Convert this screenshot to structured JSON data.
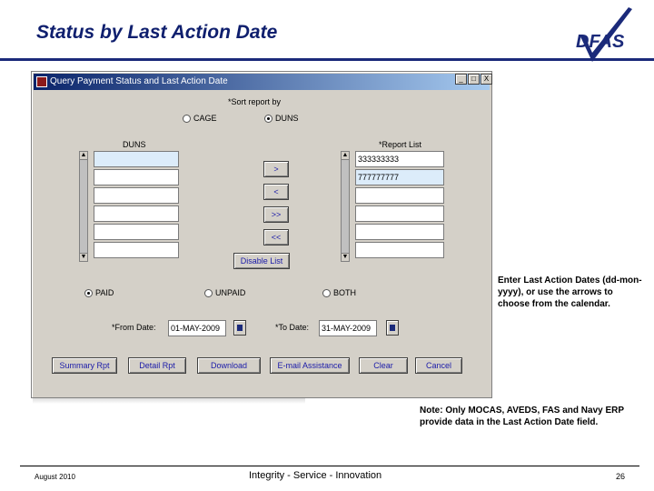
{
  "slide": {
    "title": "Status by Last Action Date"
  },
  "window": {
    "title": "Query Payment Status and Last Action Date",
    "controls": {
      "minimize": "_",
      "maximize": "□",
      "close": "X"
    }
  },
  "sort": {
    "label": "*Sort report by",
    "options": [
      {
        "label": "CAGE",
        "selected": false
      },
      {
        "label": "DUNS",
        "selected": true
      }
    ]
  },
  "left_list": {
    "header": "DUNS",
    "items": [
      "",
      "",
      "",
      "",
      "",
      ""
    ]
  },
  "right_list": {
    "header": "*Report List",
    "items": [
      "333333333",
      "777777777",
      "",
      "",
      "",
      ""
    ]
  },
  "transfer_buttons": [
    ">",
    "<",
    ">>",
    "<<"
  ],
  "disable_list_button": "Disable List",
  "status": {
    "options": [
      {
        "label": "PAID",
        "selected": true
      },
      {
        "label": "UNPAID",
        "selected": false
      },
      {
        "label": "BOTH",
        "selected": false
      }
    ]
  },
  "dates": {
    "from_label": "*From Date:",
    "from_value": "01-MAY-2009",
    "to_label": "*To Date:",
    "to_value": "31-MAY-2009"
  },
  "actions": [
    "Summary Rpt",
    "Detail Rpt",
    "Download",
    "E-mail Assistance",
    "Clear",
    "Cancel"
  ],
  "notes": {
    "callout": "Enter Last Action Dates (dd-mon-yyyy), or use the arrows to choose from the calendar.",
    "note": "Note:  Only MOCAS, AVEDS, FAS and Navy ERP provide data in the Last Action Date field."
  },
  "footer": {
    "date": "August 2010",
    "tagline": "Integrity - Service - Innovation",
    "page": "26"
  },
  "colors": {
    "title": "#0f1f6e",
    "rule": "#1b2a7a",
    "button_text": "#1a1aa8",
    "window_bg": "#d4d0c8"
  }
}
